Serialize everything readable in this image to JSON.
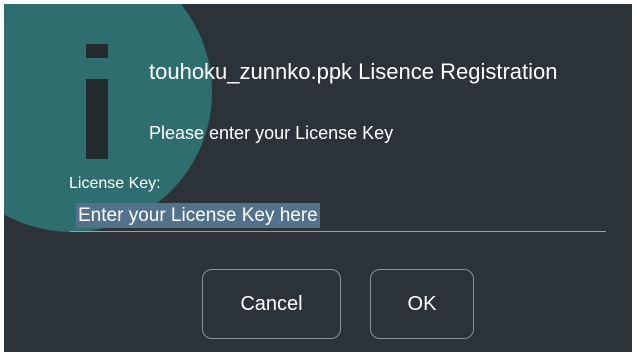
{
  "dialog": {
    "title": "touhoku_zunnko.ppk Lisence Registration",
    "prompt": "Please enter your License Key",
    "icon": "info-icon",
    "accent_color": "#2f6e6f",
    "background_color": "#2b3238"
  },
  "license_field": {
    "label": "License Key:",
    "value": "",
    "placeholder": "Enter your License Key here"
  },
  "buttons": {
    "cancel_label": "Cancel",
    "ok_label": "OK"
  }
}
